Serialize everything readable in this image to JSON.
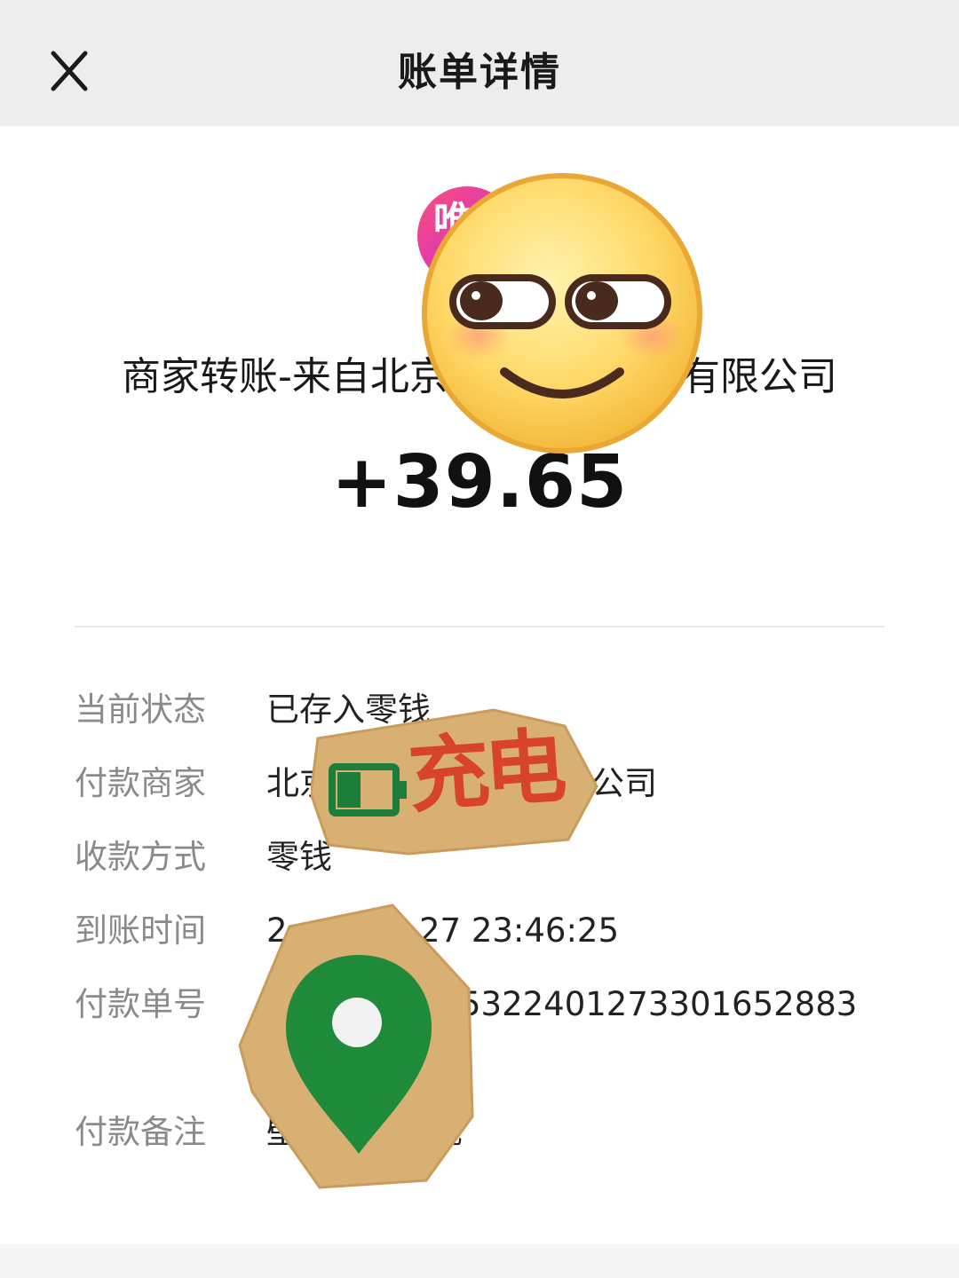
{
  "header": {
    "title": "账单详情",
    "close_icon": "close-icon"
  },
  "summary": {
    "merchant_logo_text": "唯",
    "title_left": "商家转账-来自北京",
    "title_right": "有限公司",
    "amount": "+39.65"
  },
  "details": [
    {
      "label": "当前状态",
      "value": "已存入零钱"
    },
    {
      "label": "付款商家",
      "value": "北京",
      "value_suffix": "公司"
    },
    {
      "label": "收款方式",
      "value": "零钱"
    },
    {
      "label": "到账时间",
      "value": "2",
      "value_suffix": "27 23:46:25"
    },
    {
      "label": "付款单号",
      "value": "",
      "value_suffix": "5322401273301652883"
    },
    {
      "label": "付款备注",
      "value": "壁",
      "value_suffix": "现"
    }
  ],
  "stickers": {
    "face": "smirk-emoji-sticker",
    "charged": {
      "text": "充电",
      "icon": "battery-icon"
    },
    "location": "location-pin-icon"
  },
  "colors": {
    "header_bg": "#ededed",
    "label": "#8a8a8a",
    "value": "#222222",
    "sticker_paper": "#d9b073",
    "pin_green": "#1e8a3a",
    "charge_red": "#d84429"
  }
}
